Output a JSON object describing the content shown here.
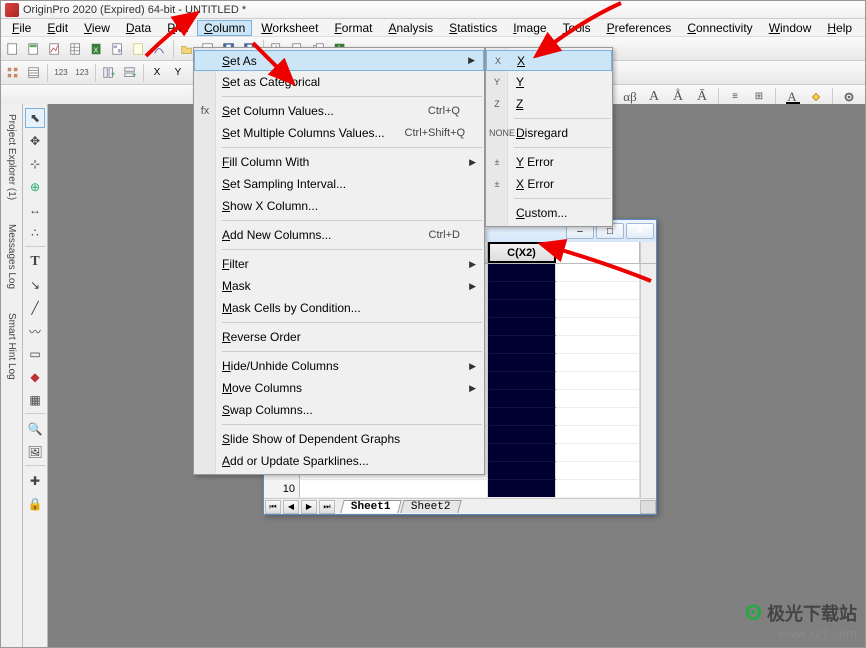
{
  "window_title": "OriginPro 2020 (Expired) 64-bit - UNTITLED *",
  "menubar": [
    "File",
    "Edit",
    "View",
    "Data",
    "Plot",
    "Column",
    "Worksheet",
    "Format",
    "Analysis",
    "Statistics",
    "Image",
    "Tools",
    "Preferences",
    "Connectivity",
    "Window",
    "Help"
  ],
  "active_menu_index": 5,
  "column_menu": {
    "items": [
      {
        "label": "Set As",
        "submenu": true,
        "highlight": true
      },
      {
        "label": "Set as Categorical"
      },
      {
        "sep": true
      },
      {
        "label": "Set Column Values...",
        "shortcut": "Ctrl+Q",
        "icon": "fx"
      },
      {
        "label": "Set Multiple Columns Values...",
        "shortcut": "Ctrl+Shift+Q"
      },
      {
        "sep": true
      },
      {
        "label": "Fill Column With",
        "submenu": true
      },
      {
        "label": "Set Sampling Interval..."
      },
      {
        "label": "Show X Column..."
      },
      {
        "sep": true
      },
      {
        "label": "Add New Columns...",
        "shortcut": "Ctrl+D"
      },
      {
        "sep": true
      },
      {
        "label": "Filter",
        "submenu": true
      },
      {
        "label": "Mask",
        "submenu": true
      },
      {
        "label": "Mask Cells by Condition..."
      },
      {
        "sep": true
      },
      {
        "label": "Reverse Order"
      },
      {
        "sep": true
      },
      {
        "label": "Hide/Unhide Columns",
        "submenu": true
      },
      {
        "label": "Move Columns",
        "submenu": true
      },
      {
        "label": "Swap Columns..."
      },
      {
        "sep": true
      },
      {
        "label": "Slide Show of Dependent Graphs"
      },
      {
        "label": "Add or Update Sparklines..."
      }
    ]
  },
  "set_as_submenu": {
    "items": [
      {
        "icon": "X",
        "label": "X",
        "highlight": true
      },
      {
        "icon": "Y",
        "label": "Y"
      },
      {
        "icon": "Z",
        "label": "Z"
      },
      {
        "sep": true
      },
      {
        "icon": "NONE",
        "label": "Disregard"
      },
      {
        "sep": true
      },
      {
        "icon": "±",
        "label": "Y Error"
      },
      {
        "icon": "±",
        "label": "X Error"
      },
      {
        "sep": true
      },
      {
        "label": "Custom..."
      }
    ]
  },
  "side_tabs": [
    "Project Explorer (1)",
    "Messages Log",
    "Smart Hint Log"
  ],
  "workbook": {
    "header": "C(X2)",
    "last_row": "10",
    "sheets": [
      "Sheet1",
      "Sheet2"
    ],
    "window_buttons": {
      "min": "–",
      "max": "□",
      "close": "✕"
    }
  },
  "watermark": {
    "text": "极光下载站",
    "url": "www.xz7.com"
  }
}
